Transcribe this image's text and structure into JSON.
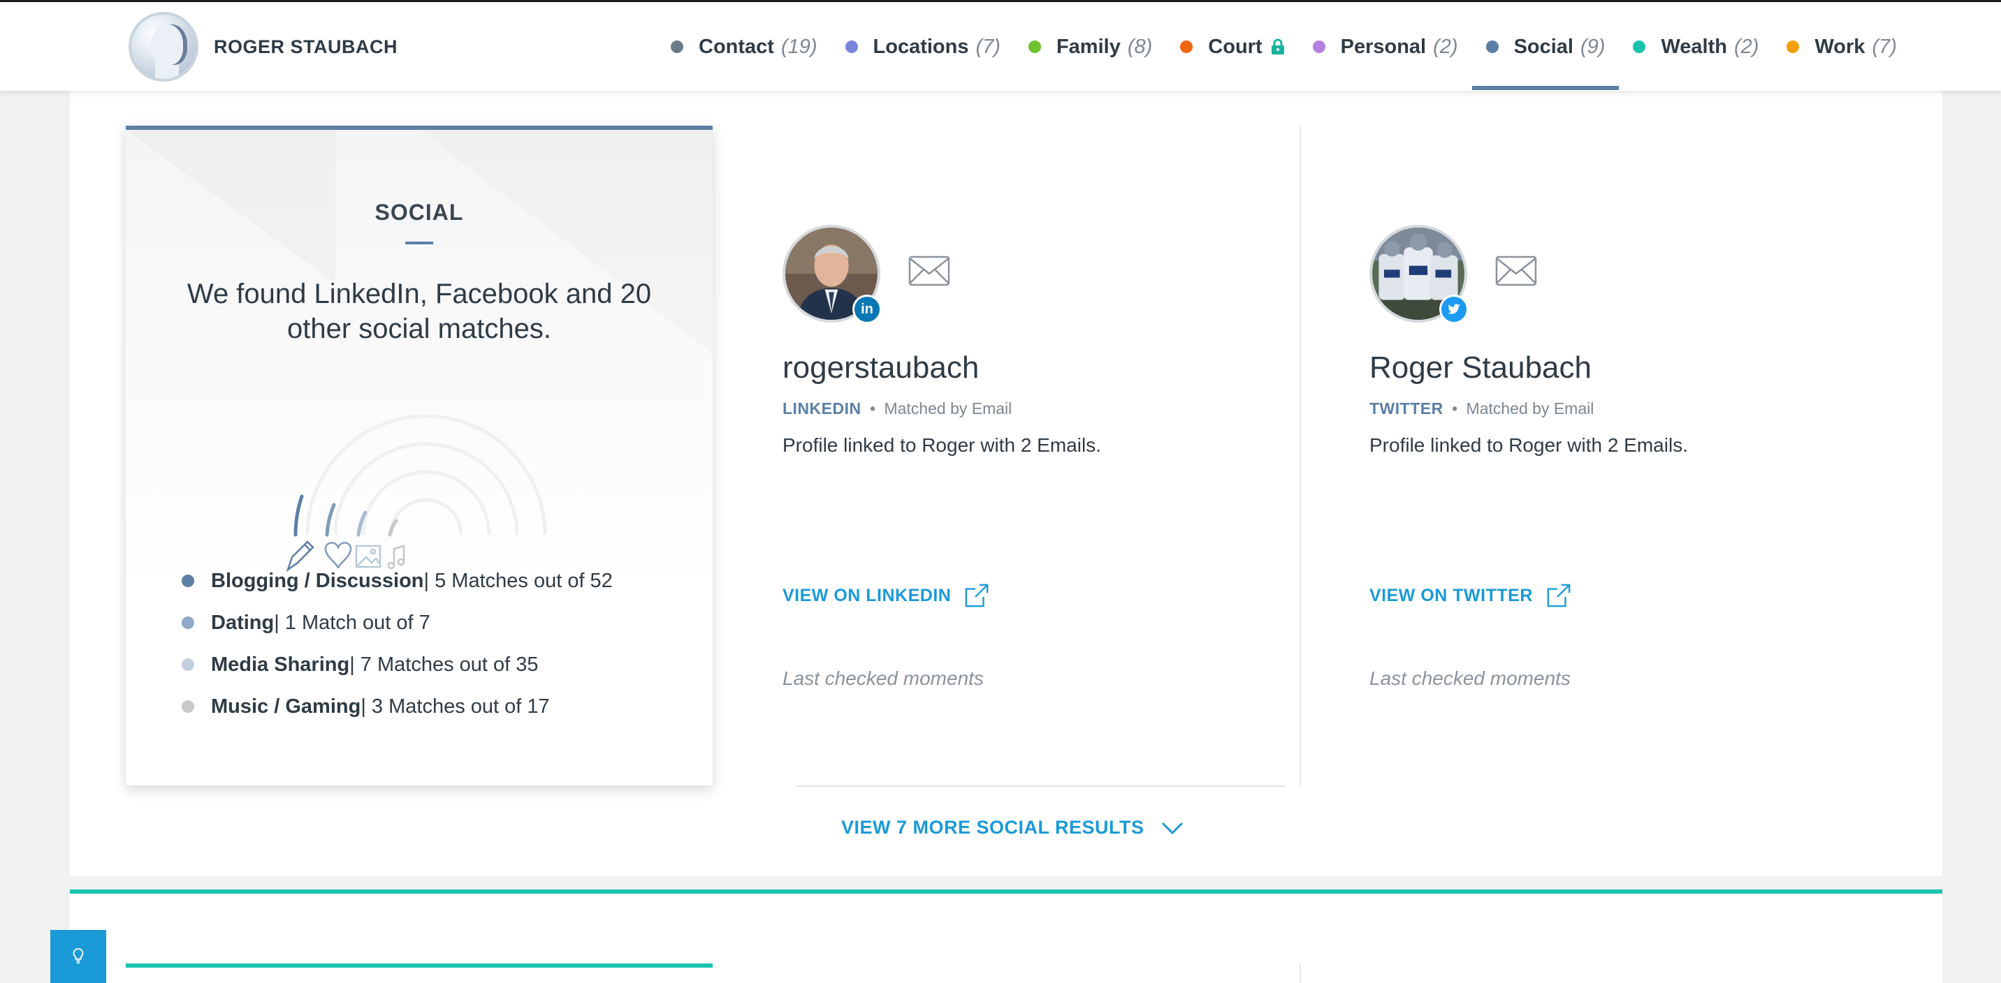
{
  "header": {
    "name": "ROGER STAUBACH",
    "nav": [
      {
        "label": "Contact",
        "count": "(19)",
        "color": "#6b7a89",
        "locked": false,
        "active": false
      },
      {
        "label": "Locations",
        "count": "(7)",
        "color": "#7b84dc",
        "locked": false,
        "active": false
      },
      {
        "label": "Family",
        "count": "(8)",
        "color": "#6fc12f",
        "locked": false,
        "active": false
      },
      {
        "label": "Court",
        "count": "",
        "color": "#f0650f",
        "locked": true,
        "active": false
      },
      {
        "label": "Personal",
        "count": "(2)",
        "color": "#b77fe0",
        "locked": false,
        "active": false
      },
      {
        "label": "Social",
        "count": "(9)",
        "color": "#5b7fa5",
        "locked": false,
        "active": true
      },
      {
        "label": "Wealth",
        "count": "(2)",
        "color": "#19c3ad",
        "locked": false,
        "active": false
      },
      {
        "label": "Work",
        "count": "(7)",
        "color": "#f59e0b",
        "locked": false,
        "active": false
      }
    ]
  },
  "summary": {
    "title": "SOCIAL",
    "text": "We found LinkedIn, Facebook and 20 other social matches.",
    "categories": [
      {
        "name": "Blogging / Discussion",
        "detail": " | 5 Matches out of 52",
        "color": "#5b7fa5"
      },
      {
        "name": "Dating",
        "detail": " | 1 Match out of 7",
        "color": "#8fa9c6"
      },
      {
        "name": "Media Sharing",
        "detail": " | 7 Matches out of 35",
        "color": "#c2cfdc"
      },
      {
        "name": "Music / Gaming",
        "detail": " | 3 Matches out of 17",
        "color": "#c8c8c8"
      }
    ]
  },
  "profiles": [
    {
      "username": "rogerstaubach",
      "network": "LINKEDIN",
      "match": "Matched by Email",
      "description": "Profile linked to Roger with 2 Emails.",
      "link": "VIEW ON LINKEDIN",
      "checked": "Last checked moments",
      "badge_color": "#0a77b5",
      "badge_icon": "linkedin-icon"
    },
    {
      "username": "Roger Staubach",
      "network": "TWITTER",
      "match": "Matched by Email",
      "description": "Profile linked to Roger with 2 Emails.",
      "link": "VIEW ON TWITTER",
      "checked": "Last checked moments",
      "badge_color": "#1d9bf0",
      "badge_icon": "twitter-icon"
    }
  ],
  "more": {
    "label": "VIEW 7 MORE SOCIAL RESULTS"
  },
  "meta_separator": "•",
  "linkedin_badge_text": "in"
}
